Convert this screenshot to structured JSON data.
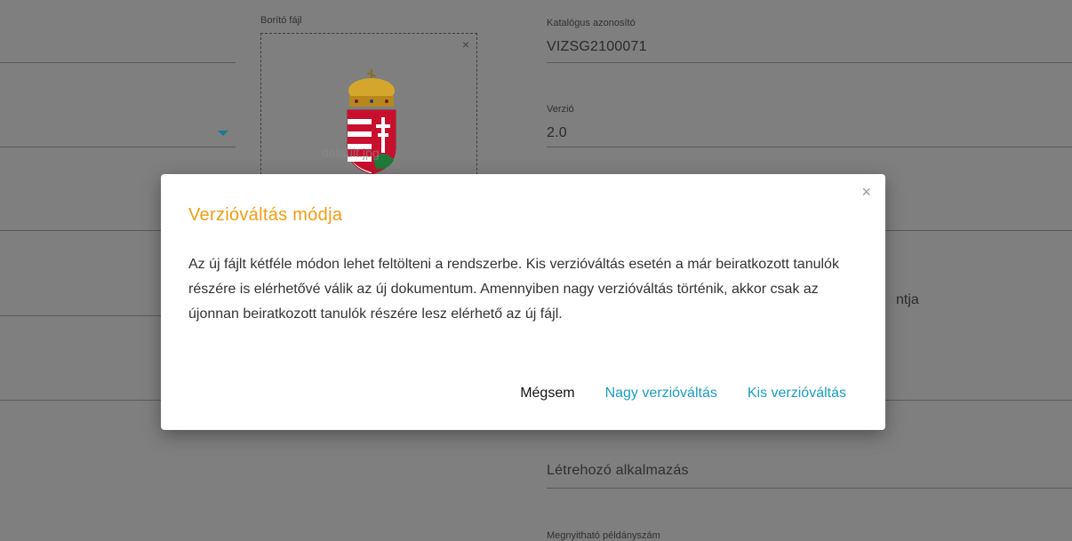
{
  "form": {
    "cover_label": "Borító fájl",
    "cover_filename": "default.jpg",
    "catalog_label": "Katalógus azonosító",
    "catalog_value": "VIZSG2100071",
    "version_label": "Verzió",
    "version_value": "2.0",
    "partial_text": "ntja",
    "creator_app_placeholder": "Létrehozó alkalmazás",
    "copies_label": "Megnyitható példányszám"
  },
  "modal": {
    "title": "Verzióváltás módja",
    "body": "Az új fájlt kétféle módon lehet feltölteni a rendszerbe. Kis verzióváltás esetén a már beiratkozott tanulók részére is elérhetővé válik az új dokumentum. Amennyiben nagy verzióváltás történik, akkor csak az újonnan beiratkozott tanulók részére lesz elérhető az új fájl.",
    "close_glyph": "×",
    "cancel_label": "Mégsem",
    "major_label": "Nagy verzióváltás",
    "minor_label": "Kis verzióváltás"
  },
  "colors": {
    "title": "#f39c12",
    "link": "#1a9dc0",
    "dropdown_arrow": "#1b7a91"
  }
}
